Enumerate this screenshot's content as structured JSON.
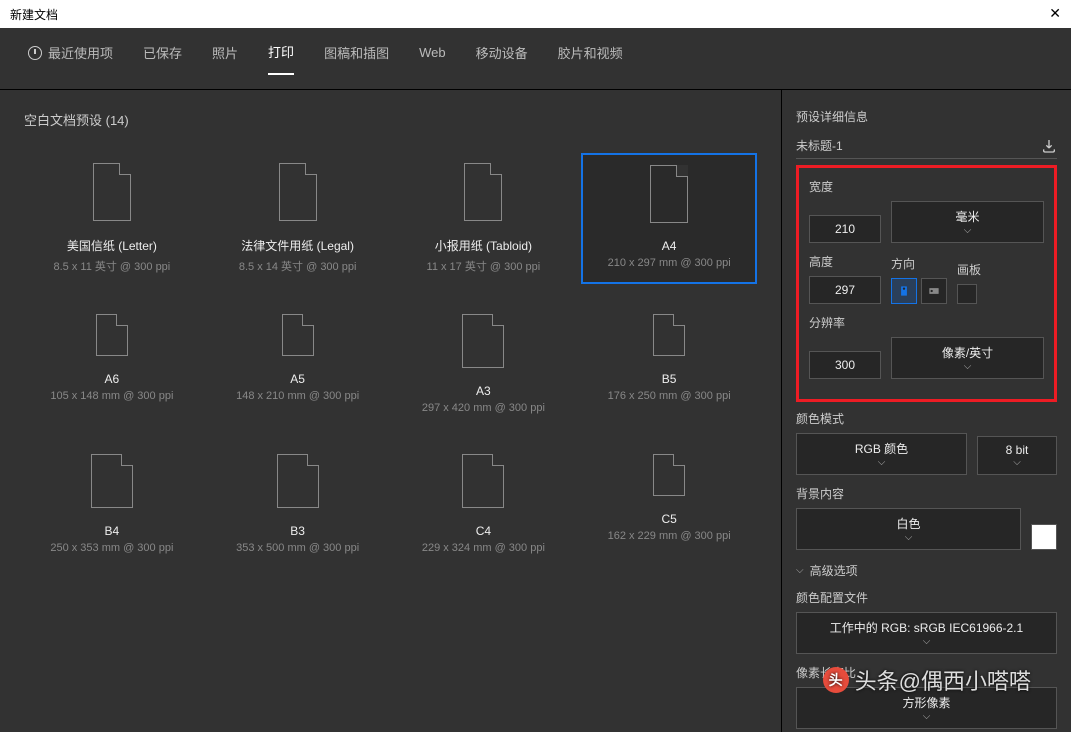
{
  "window": {
    "title": "新建文档"
  },
  "tabs": {
    "recent": "最近使用项",
    "saved": "已保存",
    "photo": "照片",
    "print": "打印",
    "art": "图稿和插图",
    "web": "Web",
    "mobile": "移动设备",
    "film": "胶片和视频"
  },
  "section_title": "空白文档预设 (14)",
  "presets": [
    {
      "name": "美国信纸 (Letter)",
      "dim": "8.5 x 11 英寸 @ 300 ppi",
      "icon": "tall"
    },
    {
      "name": "法律文件用纸 (Legal)",
      "dim": "8.5 x 14 英寸 @ 300 ppi",
      "icon": "tall"
    },
    {
      "name": "小报用纸 (Tabloid)",
      "dim": "11 x 17 英寸 @ 300 ppi",
      "icon": "tall"
    },
    {
      "name": "A4",
      "dim": "210 x 297 mm @ 300 ppi",
      "icon": "tall",
      "selected": true
    },
    {
      "name": "A6",
      "dim": "105 x 148 mm @ 300 ppi",
      "icon": "small"
    },
    {
      "name": "A5",
      "dim": "148 x 210 mm @ 300 ppi",
      "icon": "small"
    },
    {
      "name": "A3",
      "dim": "297 x 420 mm @ 300 ppi",
      "icon": "medium"
    },
    {
      "name": "B5",
      "dim": "176 x 250 mm @ 300 ppi",
      "icon": "small"
    },
    {
      "name": "B4",
      "dim": "250 x 353 mm @ 300 ppi",
      "icon": "medium"
    },
    {
      "name": "B3",
      "dim": "353 x 500 mm @ 300 ppi",
      "icon": "medium"
    },
    {
      "name": "C4",
      "dim": "229 x 324 mm @ 300 ppi",
      "icon": "medium"
    },
    {
      "name": "C5",
      "dim": "162 x 229 mm @ 300 ppi",
      "icon": "small"
    }
  ],
  "details": {
    "header": "预设详细信息",
    "doc_name": "未标题-1",
    "width_label": "宽度",
    "width_value": "210",
    "unit": "毫米",
    "height_label": "高度",
    "height_value": "297",
    "orientation_label": "方向",
    "artboard_label": "画板",
    "resolution_label": "分辨率",
    "resolution_value": "300",
    "resolution_unit": "像素/英寸",
    "color_mode_label": "颜色模式",
    "color_mode": "RGB 颜色",
    "bit_depth": "8 bit",
    "background_label": "背景内容",
    "background": "白色",
    "advanced_label": "高级选项",
    "profile_label": "颜色配置文件",
    "profile": "工作中的 RGB: sRGB IEC61966-2.1",
    "aspect_label": "像素长宽比",
    "aspect": "方形像素"
  },
  "watermark": "头条@偶西小嗒嗒"
}
